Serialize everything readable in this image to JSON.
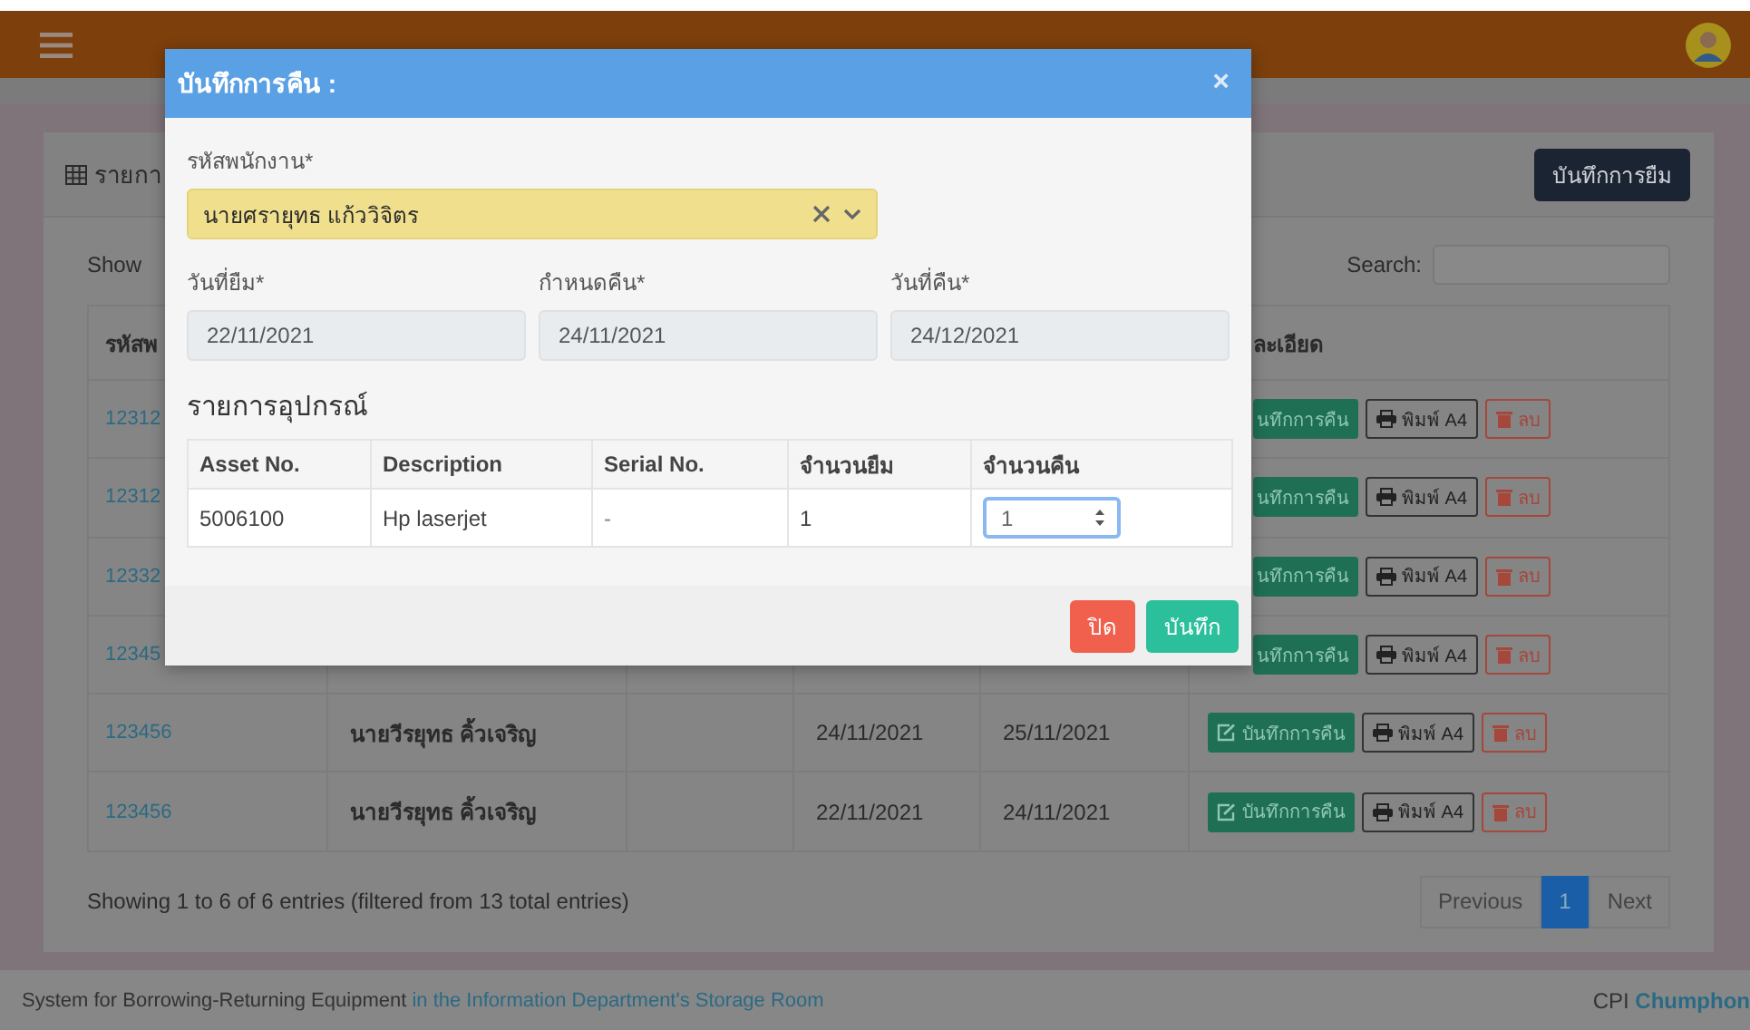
{
  "page_header": {
    "title": "รายกา",
    "button": "บันทึกการยืม"
  },
  "controls": {
    "show_label": "Show",
    "search_label": "Search:"
  },
  "table": {
    "column_1": "รหัสพ",
    "column_6": "ละเอียด",
    "rows": [
      {
        "code": "12312",
        "return_button": {
          "label": "นทึกการคืน",
          "icon": false
        },
        "print_button": "พิมพ์ A4",
        "delete_button": "ลบ"
      },
      {
        "code": "12312",
        "return_button": {
          "label": "นทึกการคืน",
          "icon": false
        },
        "print_button": "พิมพ์ A4",
        "delete_button": "ลบ"
      },
      {
        "code": "12332",
        "return_button": {
          "label": "นทึกการคืน",
          "icon": false
        },
        "print_button": "พิมพ์ A4",
        "delete_button": "ลบ"
      },
      {
        "code": "12345",
        "return_button": {
          "label": "นทึกการคืน",
          "icon": false
        },
        "print_button": "พิมพ์ A4",
        "delete_button": "ลบ"
      },
      {
        "code": "123456",
        "name": "นายวีรยุทธ คิ้วเจริญ",
        "date_borrow": "24/11/2021",
        "date_due": "25/11/2021",
        "return_button": {
          "label": "บันทึกการคืน",
          "icon": true
        },
        "print_button": "พิมพ์ A4",
        "delete_button": "ลบ"
      },
      {
        "code": "123456",
        "name": "นายวีรยุทธ คิ้วเจริญ",
        "date_borrow": "22/11/2021",
        "date_due": "24/11/2021",
        "return_button": {
          "label": "บันทึกการคืน",
          "icon": true
        },
        "print_button": "พิมพ์ A4",
        "delete_button": "ลบ"
      }
    ]
  },
  "info": "Showing 1 to 6 of 6 entries (filtered from 13 total entries)",
  "pagination": [
    {
      "label": "Previous",
      "selected": false
    },
    {
      "label": "1",
      "selected": true
    },
    {
      "label": "Next",
      "selected": false
    }
  ],
  "footer": {
    "text": "System for Borrowing-Returning Equipment",
    "link": "in the Information Department's Storage Room",
    "org": "CPI",
    "org_bold": "Chumphon"
  },
  "modal": {
    "title": "บันทึกการคืน :",
    "close": "×",
    "employee": {
      "label": "รหัสพนักงาน*",
      "value": "นายศรายุทธ แก้ววิจิตร"
    },
    "dates": [
      {
        "label": "วันที่ยืม*",
        "value": "22/11/2021"
      },
      {
        "label": "กำหนดคืน*",
        "value": "24/11/2021"
      },
      {
        "label": "วันที่คืน*",
        "value": "24/12/2021"
      }
    ],
    "items_title": "รายการอุปกรณ์",
    "columns": [
      "Asset No.",
      "Description",
      "Serial No.",
      "จำนวนยืม",
      "จำนวนคืน"
    ],
    "rows": [
      {
        "asset": "5006100",
        "description": "Hp laserjet",
        "serial": "-",
        "borrowed": "1",
        "returned": "1"
      }
    ],
    "buttons": [
      {
        "label": "ปิด",
        "kind": "danger"
      },
      {
        "label": "บันทึก",
        "kind": "success"
      }
    ]
  }
}
